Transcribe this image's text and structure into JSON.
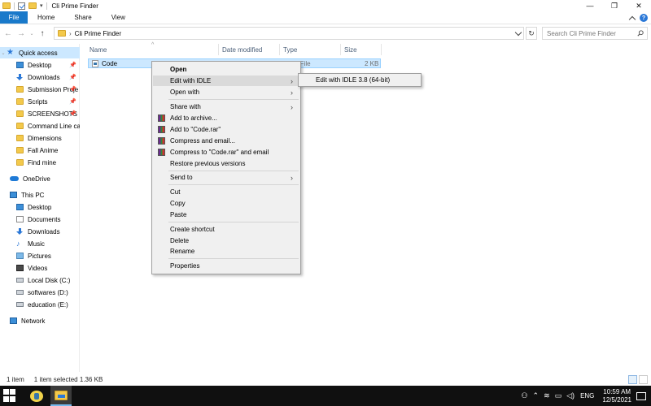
{
  "window": {
    "title": "Cli Prime Finder",
    "controls": {
      "minimize": "—",
      "maximize": "❐",
      "close": "✕"
    }
  },
  "ribbon": {
    "tabs": [
      "File",
      "Home",
      "Share",
      "View"
    ]
  },
  "address": {
    "path": "Cli Prime Finder",
    "search_placeholder": "Search Cli Prime Finder"
  },
  "sidebar": {
    "quick_access": "Quick access",
    "pinned": [
      {
        "label": "Desktop",
        "icon": "desktop-icon"
      },
      {
        "label": "Downloads",
        "icon": "download-icon"
      },
      {
        "label": "Submission Proje",
        "icon": "folder-icon"
      },
      {
        "label": "Scripts",
        "icon": "folder-icon"
      },
      {
        "label": "SCREENSHOTS",
        "icon": "folder-icon"
      },
      {
        "label": "Command Line calc",
        "icon": "folder-icon"
      },
      {
        "label": "Dimensions",
        "icon": "folder-icon"
      },
      {
        "label": "Fall Anime",
        "icon": "folder-icon"
      },
      {
        "label": "Find mine",
        "icon": "folder-icon"
      }
    ],
    "onedrive": "OneDrive",
    "this_pc": "This PC",
    "pc_items": [
      {
        "label": "Desktop",
        "icon": "desktop-icon"
      },
      {
        "label": "Documents",
        "icon": "documents-icon"
      },
      {
        "label": "Downloads",
        "icon": "download-icon"
      },
      {
        "label": "Music",
        "icon": "music-icon"
      },
      {
        "label": "Pictures",
        "icon": "pictures-icon"
      },
      {
        "label": "Videos",
        "icon": "videos-icon"
      },
      {
        "label": "Local Disk (C:)",
        "icon": "disk-icon"
      },
      {
        "label": "softwares (D:)",
        "icon": "disk-icon"
      },
      {
        "label": "education (E:)",
        "icon": "disk-icon"
      }
    ],
    "network": "Network"
  },
  "columns": {
    "name": "Name",
    "date_modified": "Date modified",
    "type": "Type",
    "size": "Size"
  },
  "files": [
    {
      "name": "Code",
      "type_partial": "n File",
      "size": "2 KB"
    }
  ],
  "context_menu": {
    "open": "Open",
    "edit_with_idle": "Edit with IDLE",
    "open_with": "Open with",
    "share_with": "Share with",
    "add_to_archive": "Add to archive...",
    "add_to_rar": "Add to \"Code.rar\"",
    "compress_email": "Compress and email...",
    "compress_rar_email": "Compress to \"Code.rar\" and email",
    "restore_versions": "Restore previous versions",
    "send_to": "Send to",
    "cut": "Cut",
    "copy": "Copy",
    "paste": "Paste",
    "create_shortcut": "Create shortcut",
    "delete": "Delete",
    "rename": "Rename",
    "properties": "Properties"
  },
  "submenu": {
    "edit_idle_38": "Edit with IDLE 3.8 (64-bit)"
  },
  "status": {
    "item_count": "1 item",
    "selection": "1 item selected  1.36 KB"
  },
  "taskbar": {
    "time": "10:59 AM",
    "date": "12/5/2021",
    "language": "ENG"
  }
}
